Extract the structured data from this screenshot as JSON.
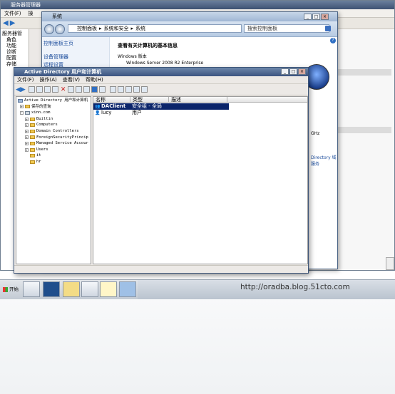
{
  "server_manager": {
    "title": "服务器管理器",
    "menu": [
      "文件(F)",
      "操"
    ],
    "tree": [
      "服务器管",
      "角色",
      "功能",
      "诊断",
      "配置",
      "存储"
    ]
  },
  "system_window": {
    "title": "系统",
    "breadcrumb": [
      "控制面板",
      "系统和安全",
      "系统"
    ],
    "search_placeholder": "搜索控制面板",
    "left_links": [
      "控制面板主页",
      "设备管理器",
      "远程设置"
    ],
    "heading": "查看有关计算机的基本信息",
    "section_edition": "Windows 版本",
    "edition": "Windows Server 2008 R2 Enterprise",
    "ghz": "GHz",
    "link_ad_domain": "Directory 域服务"
  },
  "aduc": {
    "title": "Active Directory 用户和计算机",
    "menu": [
      "文件(F)",
      "操作(A)",
      "查看(V)",
      "帮助(H)"
    ],
    "tree": [
      {
        "label": "Active Directory 用户和计算机",
        "level": 0
      },
      {
        "label": "保存的查询",
        "level": 1
      },
      {
        "label": "xinn.com",
        "level": 1
      },
      {
        "label": "Builtin",
        "level": 2
      },
      {
        "label": "Computers",
        "level": 2
      },
      {
        "label": "Domain Controllers",
        "level": 2
      },
      {
        "label": "ForeignSecurityPrincip",
        "level": 2
      },
      {
        "label": "Managed Service Accour",
        "level": 2
      },
      {
        "label": "Users",
        "level": 2
      },
      {
        "label": "it",
        "level": 2
      },
      {
        "label": "hr",
        "level": 2
      }
    ],
    "columns": [
      "名称",
      "类型",
      "描述"
    ],
    "rows": [
      {
        "name": "DAClient",
        "type": "安全组 - 全局",
        "desc": "",
        "selected": true
      },
      {
        "name": "lucy",
        "type": "用户",
        "desc": "",
        "selected": false
      }
    ]
  },
  "taskbar": {
    "start": "开始"
  },
  "watermark": "http://oradba.blog.51cto.com"
}
